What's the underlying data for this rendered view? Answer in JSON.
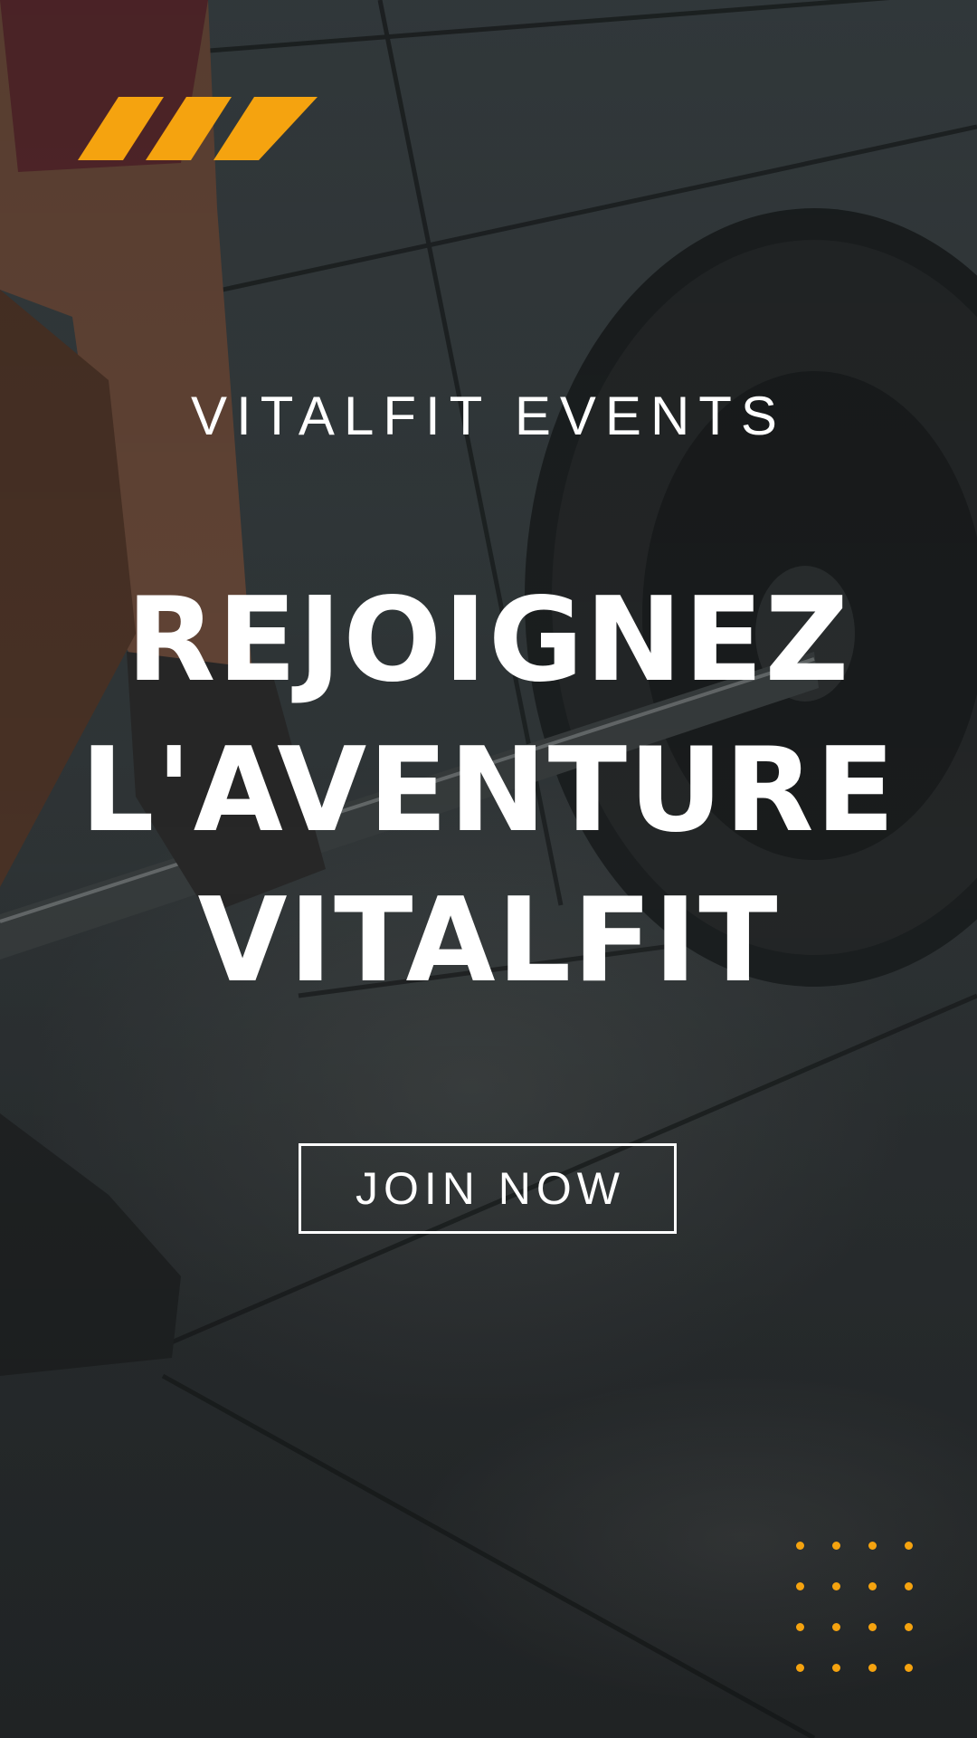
{
  "brand": {
    "name": "VITALFIT EVENTS"
  },
  "hero": {
    "lines": [
      "REJOIGNEZ",
      "L'AVENTURE",
      "VITALFIT"
    ]
  },
  "cta": {
    "label": "JOIN NOW"
  },
  "colors": {
    "accent": "#f5a30f",
    "text": "#ffffff"
  },
  "background": {
    "subject": "barbell-deadlift-photo"
  },
  "decor": {
    "stripes_icon": "diagonal-stripes-icon",
    "dots_icon": "dot-grid-icon"
  }
}
